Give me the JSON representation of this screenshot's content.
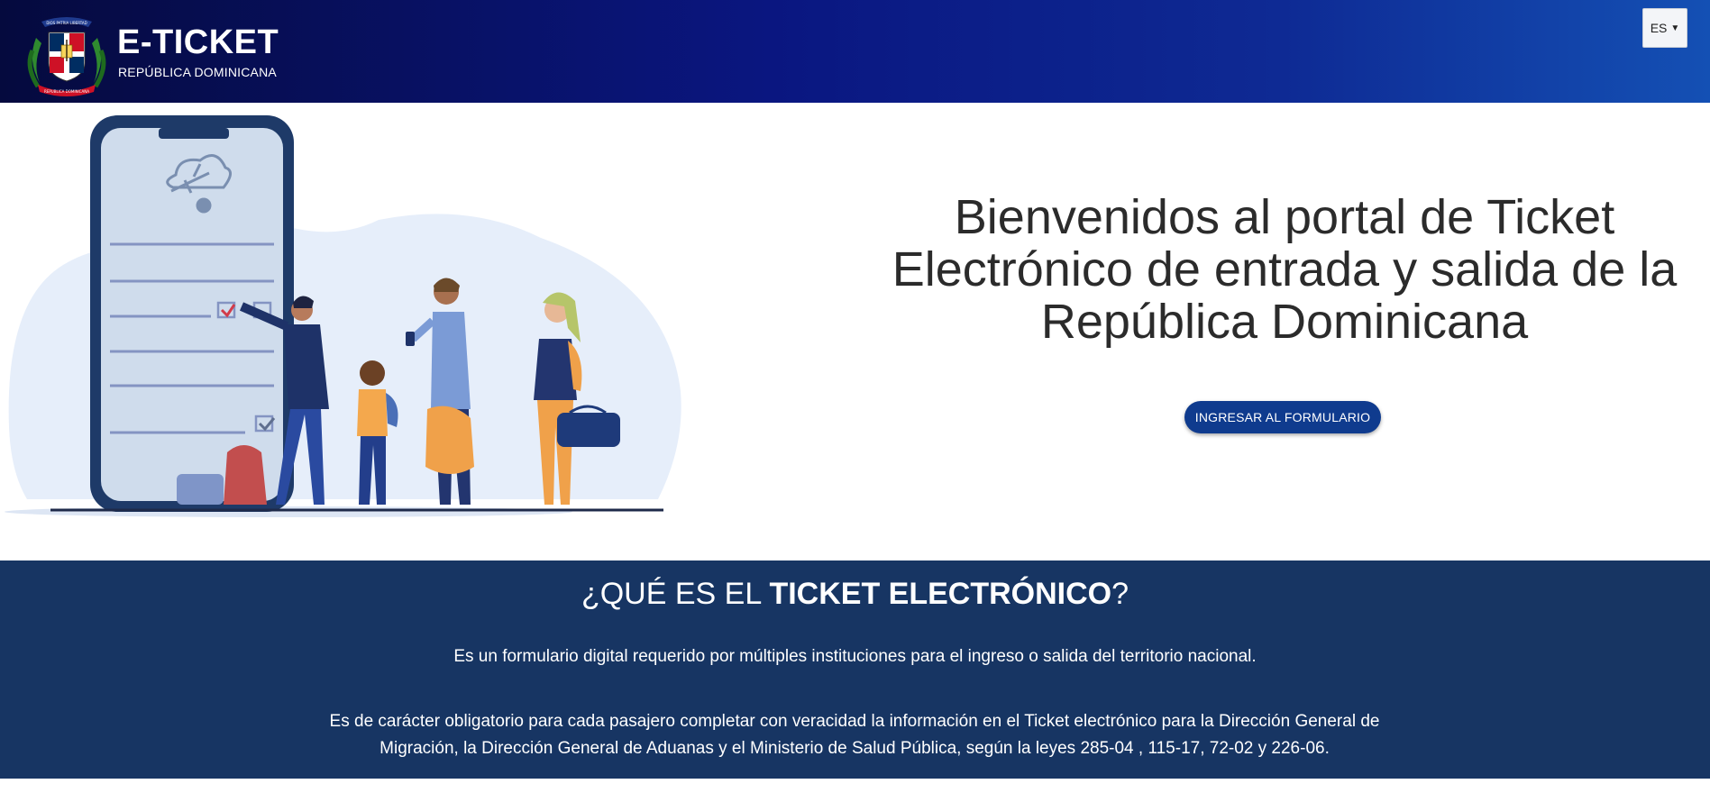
{
  "header": {
    "brand_title": "E-TICKET",
    "brand_subtitle": "REPÚBLICA DOMINICANA",
    "language": {
      "selected": "ES"
    }
  },
  "hero": {
    "title": "Bienvenidos al portal de Ticket Electrónico de entrada y salida de la República Dominicana",
    "cta_label": "INGRESAR AL FORMULARIO"
  },
  "info": {
    "title_prefix": "¿QUÉ ES EL ",
    "title_bold": "TICKET ELECTRÓNICO",
    "title_suffix": "?",
    "paragraph_1": "Es un formulario digital requerido por múltiples instituciones para el ingreso o salida del territorio nacional.",
    "paragraph_2": "Es de carácter obligatorio para cada pasajero completar con veracidad la información en el Ticket electrónico para la Dirección General de Migración, la Dirección General de Aduanas y el Ministerio de Salud Pública, según la leyes 285-04 , 115-17, 72-02 y 226-06."
  },
  "colors": {
    "header_start": "#050a3e",
    "header_end": "#1450b4",
    "cta": "#0f3b8e",
    "info_bg": "#173563"
  },
  "icons": [
    "coat-of-arms-logo",
    "language-caret-icon",
    "airplane-cloud-icon"
  ]
}
